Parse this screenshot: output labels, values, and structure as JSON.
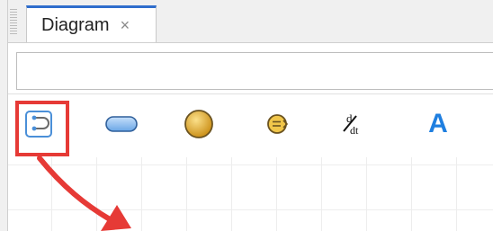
{
  "tab": {
    "label": "Diagram",
    "close_glyph": "×"
  },
  "path_input": {
    "value": "",
    "placeholder": ""
  },
  "toolbar": {
    "tools": [
      {
        "icon": "connector-icon"
      },
      {
        "icon": "rounded-rectangle-icon"
      },
      {
        "icon": "circle-icon"
      },
      {
        "icon": "event-icon"
      },
      {
        "icon": "derivative-icon"
      },
      {
        "icon": "text-icon",
        "glyph": "A"
      }
    ]
  },
  "colors": {
    "annotation": "#e63a36",
    "tab_accent": "#2f6dcc",
    "shape_blue": "#7fb6f0",
    "shape_gold": "#e0a81c",
    "text_blue": "#1f7fe0"
  }
}
